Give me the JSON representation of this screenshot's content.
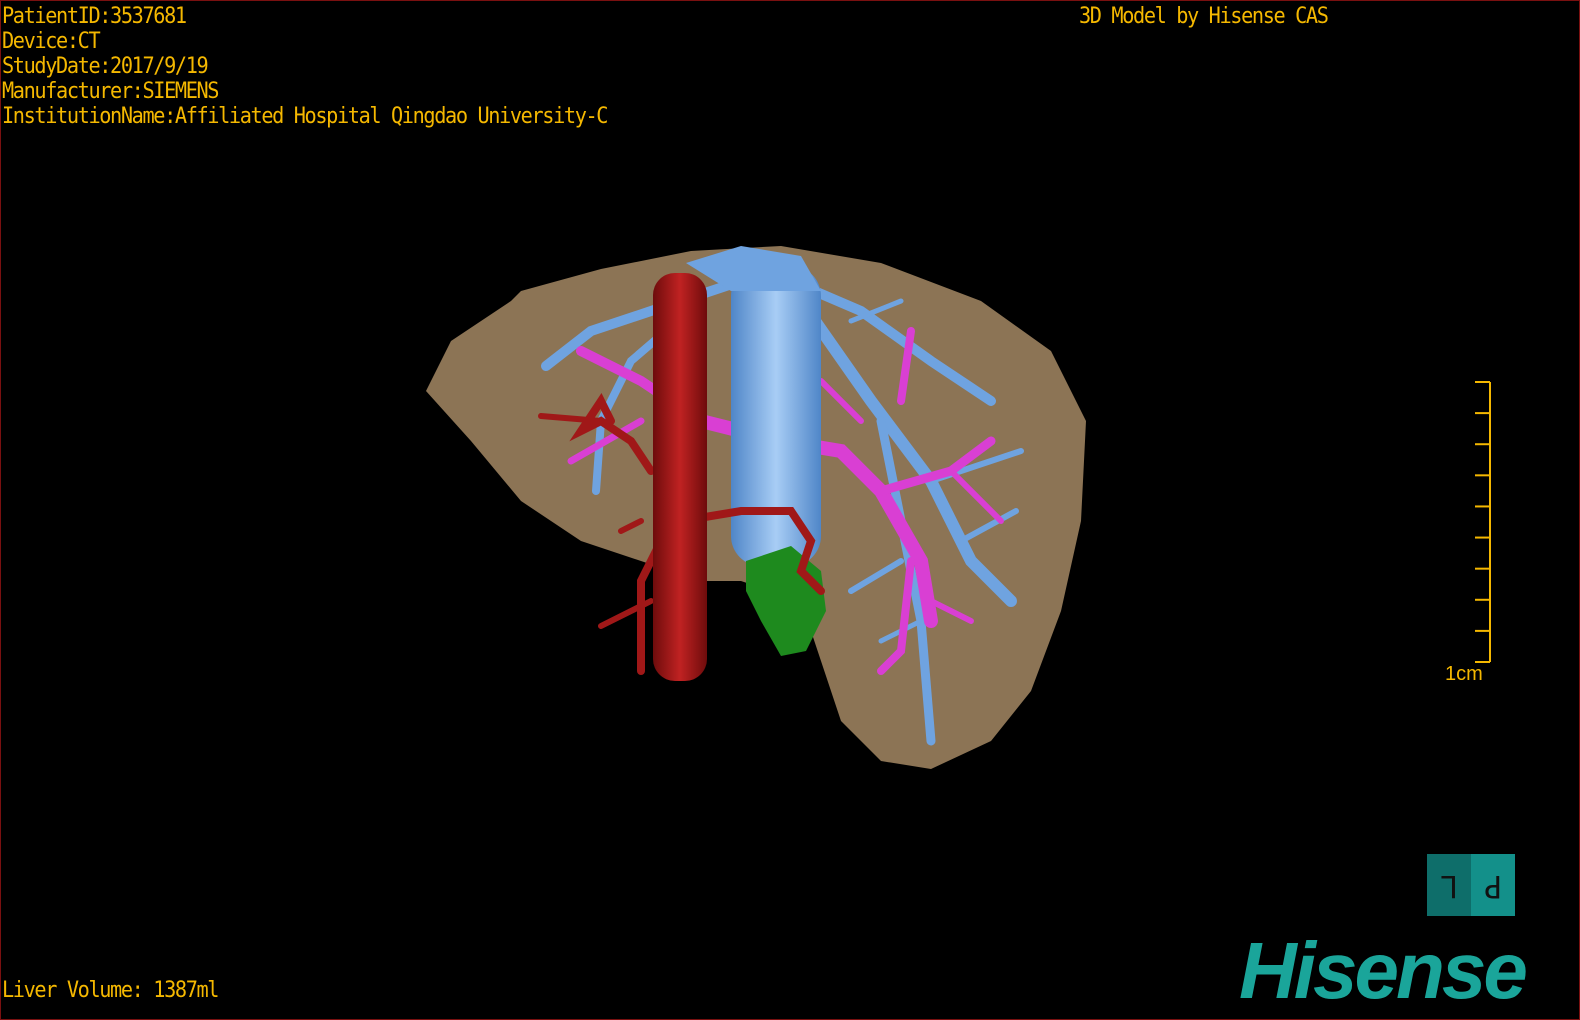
{
  "info": {
    "patient_id": "PatientID:3537681",
    "device": "Device:CT",
    "study_date": "StudyDate:2017/9/19",
    "manufacturer": "Manufacturer:SIEMENS",
    "institution": "InstitutionName:Affiliated Hospital Qingdao University-C"
  },
  "brand_text": "3D Model by Hisense CAS",
  "liver_volume": "Liver Volume: 1387ml",
  "scale_bar": {
    "label": "1cm",
    "ticks": 10
  },
  "orientation": {
    "left": "L",
    "right": "P",
    "colors": [
      "#0e6e6a",
      "#13908a"
    ]
  },
  "logo": "Hisense",
  "colors": {
    "overlay_text": "#f5b800",
    "liver": "#8c7455",
    "hepatic_vein": "#6fa3e0",
    "portal_vein": "#d93fd3",
    "artery": "#a01818",
    "tumor": "#1e8a1e",
    "logo": "#1aa59a"
  }
}
